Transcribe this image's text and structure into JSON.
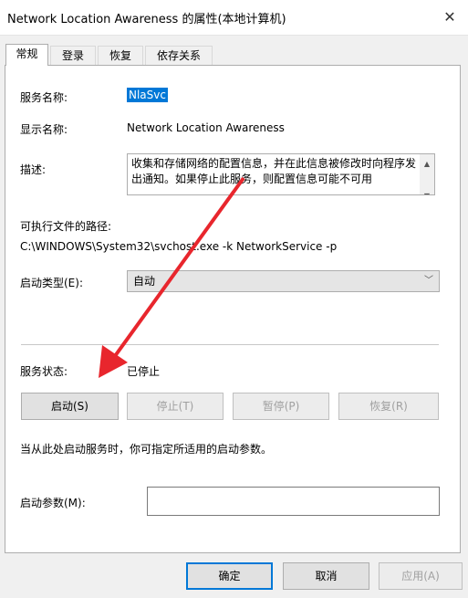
{
  "window": {
    "title": "Network Location Awareness 的属性(本地计算机)",
    "close_icon": "close-icon"
  },
  "tabs": [
    {
      "label": "常规",
      "active": true
    },
    {
      "label": "登录",
      "active": false
    },
    {
      "label": "恢复",
      "active": false
    },
    {
      "label": "依存关系",
      "active": false
    }
  ],
  "general": {
    "service_name_label": "服务名称:",
    "service_name": "NlaSvc",
    "display_name_label": "显示名称:",
    "display_name": "Network Location Awareness",
    "description_label": "描述:",
    "description": "收集和存储网络的配置信息，并在此信息被修改时向程序发出通知。如果停止此服务，则配置信息可能不可用",
    "path_label": "可执行文件的路径:",
    "path": "C:\\WINDOWS\\System32\\svchost.exe -k NetworkService -p",
    "startup_type_label": "启动类型(E):",
    "startup_type": "自动",
    "status_label": "服务状态:",
    "status": "已停止",
    "buttons": {
      "start": "启动(S)",
      "stop": "停止(T)",
      "pause": "暂停(P)",
      "resume": "恢复(R)"
    },
    "hint": "当从此处启动服务时，你可指定所适用的启动参数。",
    "params_label": "启动参数(M):",
    "params_value": ""
  },
  "footer": {
    "ok": "确定",
    "cancel": "取消",
    "apply": "应用(A)"
  },
  "annotation": {
    "color": "#e8262d"
  }
}
